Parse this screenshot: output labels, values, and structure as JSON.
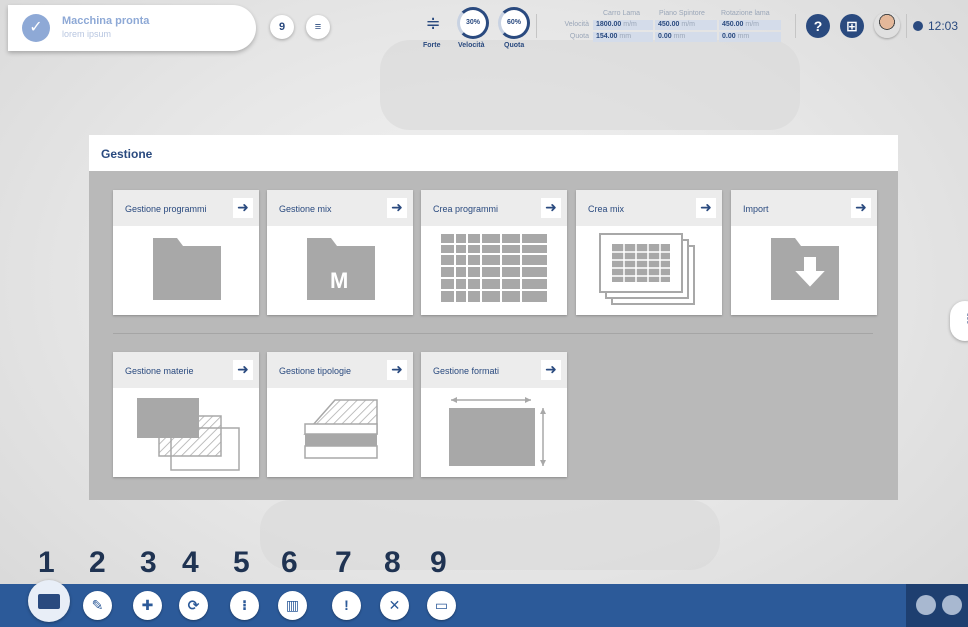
{
  "status": {
    "title": "Macchina pronta",
    "subtitle": "lorem ipsum",
    "icon": "check-icon"
  },
  "toolbar": {
    "left_buttons": [
      {
        "name": "program-icon",
        "glyph": "9"
      },
      {
        "name": "settings-dial-icon",
        "glyph": "≡"
      }
    ],
    "forte_label": "Forte",
    "velocita": {
      "label": "Velocità",
      "value": "30%"
    },
    "quota": {
      "label": "Quota",
      "value": "60%"
    },
    "clock": "12:03"
  },
  "readout": {
    "columns": [
      "Carro Lama",
      "Piano Spintore",
      "Rotazione lama"
    ],
    "velocita_label": "Velocità",
    "quota_label": "Quota",
    "velocita_values": [
      {
        "num": "1800.00",
        "unit": "m/m"
      },
      {
        "num": "450.00",
        "unit": "m/m"
      },
      {
        "num": "450.00",
        "unit": "m/m"
      }
    ],
    "quota_values": [
      {
        "num": "154.00",
        "unit": "mm"
      },
      {
        "num": "0.00",
        "unit": "mm"
      },
      {
        "num": "0.00",
        "unit": "mm"
      }
    ]
  },
  "panel": {
    "title": "Gestione",
    "row1": [
      {
        "label": "Gestione programmi",
        "art": "folder"
      },
      {
        "label": "Gestione mix",
        "art": "folder-m",
        "letter": "M"
      },
      {
        "label": "Crea programmi",
        "art": "grid"
      },
      {
        "label": "Crea mix",
        "art": "stacked-grid"
      },
      {
        "label": "Import",
        "art": "import"
      }
    ],
    "row2": [
      {
        "label": "Gestione materie",
        "art": "materials"
      },
      {
        "label": "Gestione tipologie",
        "art": "layers"
      },
      {
        "label": "Gestione formati",
        "art": "formats"
      }
    ]
  },
  "dock_numbers": [
    "1",
    "2",
    "3",
    "4",
    "5",
    "6",
    "7",
    "8",
    "9"
  ],
  "dock_icons": [
    "folder-icon",
    "edit-icon",
    "layout-icon",
    "rotate-icon",
    "pipeline-icon",
    "chart-icon",
    "alert-icon",
    "wrench-icon",
    "window-icon"
  ],
  "colors": {
    "primary": "#2a4a7f",
    "dock": "#2c5a99",
    "panel": "#b9b9b9",
    "status": "#8ea9d6"
  }
}
